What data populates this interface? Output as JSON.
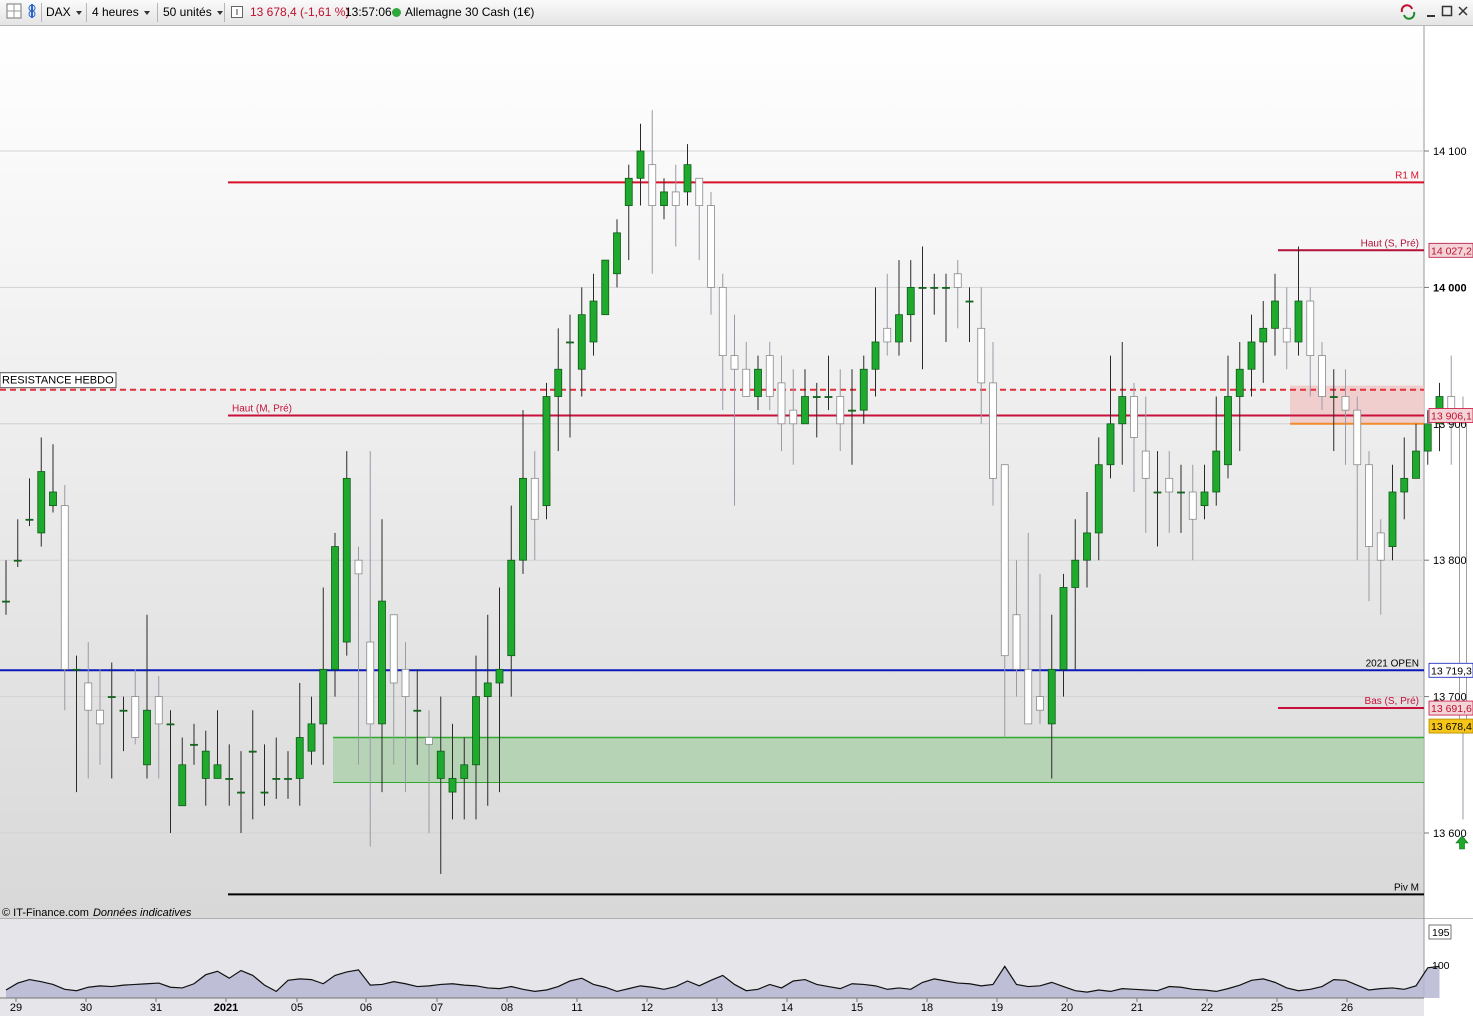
{
  "toolbar": {
    "symbol": "DAX",
    "timeframe": "4 heures",
    "units": "50 unités",
    "price_change": "13 678,4 (-1,61 %)",
    "time": "13:57:06",
    "instrument": "Allemagne 30 Cash (1€)"
  },
  "credit": {
    "source": "© IT-Finance.com",
    "note": "Données indicatives"
  },
  "colors": {
    "bull": "#1faa2e",
    "bear": "#ffffff",
    "resistance": "#d8102a",
    "open_line": "#0b18b8",
    "zone_green": "#a9cfa7",
    "zone_red": "#f0c8c8",
    "orange": "#f08a2a"
  },
  "chart_data": {
    "type": "candlestick",
    "ylim": [
      13540,
      14200
    ],
    "y_ticks": [
      {
        "value": 14100,
        "label": "14 100"
      },
      {
        "value": 14000,
        "label": "14 000"
      },
      {
        "value": 13900,
        "label": "13 900"
      },
      {
        "value": 13800,
        "label": "13 800"
      },
      {
        "value": 13700,
        "label": "13 700"
      },
      {
        "value": 13600,
        "label": "13 600"
      }
    ],
    "x_labels": [
      "29",
      "30",
      "31",
      "2021",
      "05",
      "06",
      "07",
      "08",
      "11",
      "12",
      "13",
      "14",
      "15",
      "18",
      "19",
      "20",
      "21",
      "22",
      "25",
      "26"
    ],
    "levels": [
      {
        "name": "R1 M",
        "value": 14077,
        "style": "solid",
        "color": "#d8102a"
      },
      {
        "name": "Haut (S, Pré)",
        "value": 14027.2,
        "style": "solid",
        "color": "#b3103a",
        "badge": "14 027,2"
      },
      {
        "name": "RESISTANCE HEBDO",
        "value": 13925,
        "style": "dashed",
        "color": "#e0303a"
      },
      {
        "name": "Haut (M, Pré)",
        "value": 13906.1,
        "style": "solid",
        "color": "#c8103a",
        "badge": "13 906,1"
      },
      {
        "name": "2021 OPEN",
        "value": 13719.3,
        "style": "solid",
        "color": "#0b18b8",
        "badge": "13 719,3"
      },
      {
        "name": "Bas (S, Pré)",
        "value": 13691.6,
        "style": "solid",
        "color": "#c8103a",
        "badge": "13 691,6"
      },
      {
        "name": "Piv M",
        "value": 13555,
        "style": "solid",
        "color": "#000000"
      }
    ],
    "last_price": {
      "value": 13678.4,
      "label": "13 678,4"
    },
    "zones": [
      {
        "name": "support-zone",
        "from": 13637,
        "to": 13670
      },
      {
        "name": "resistance-zone",
        "from": 13900,
        "to": 13928
      }
    ],
    "candles": [
      [
        13770,
        13770,
        13800,
        13760
      ],
      [
        13800,
        13800,
        13830,
        13795
      ],
      [
        13830,
        13830,
        13860,
        13825
      ],
      [
        13820,
        13865,
        13890,
        13810
      ],
      [
        13840,
        13850,
        13885,
        13835
      ],
      [
        13840,
        13720,
        13855,
        13690
      ],
      [
        13720,
        13720,
        13730,
        13630
      ],
      [
        13710,
        13690,
        13740,
        13640
      ],
      [
        13690,
        13680,
        13720,
        13650
      ],
      [
        13700,
        13700,
        13725,
        13640
      ],
      [
        13690,
        13690,
        13700,
        13660
      ],
      [
        13700,
        13670,
        13720,
        13665
      ],
      [
        13650,
        13690,
        13760,
        13640
      ],
      [
        13700,
        13680,
        13715,
        13640
      ],
      [
        13680,
        13680,
        13690,
        13600
      ],
      [
        13620,
        13650,
        13670,
        13620
      ],
      [
        13665,
        13665,
        13680,
        13650
      ],
      [
        13640,
        13660,
        13675,
        13620
      ],
      [
        13640,
        13650,
        13690,
        13640
      ],
      [
        13640,
        13640,
        13665,
        13620
      ],
      [
        13630,
        13630,
        13660,
        13600
      ],
      [
        13660,
        13660,
        13690,
        13610
      ],
      [
        13630,
        13630,
        13665,
        13620
      ],
      [
        13640,
        13640,
        13670,
        13625
      ],
      [
        13640,
        13640,
        13660,
        13625
      ],
      [
        13640,
        13670,
        13710,
        13620
      ],
      [
        13660,
        13680,
        13700,
        13650
      ],
      [
        13680,
        13720,
        13780,
        13650
      ],
      [
        13720,
        13810,
        13820,
        13700
      ],
      [
        13740,
        13860,
        13880,
        13730
      ],
      [
        13800,
        13790,
        13810,
        13650
      ],
      [
        13740,
        13680,
        13880,
        13590
      ],
      [
        13680,
        13770,
        13830,
        13630
      ],
      [
        13760,
        13710,
        13740,
        13650
      ],
      [
        13720,
        13700,
        13740,
        13630
      ],
      [
        13690,
        13690,
        13720,
        13650
      ],
      [
        13670,
        13665,
        13690,
        13600
      ],
      [
        13640,
        13660,
        13700,
        13570
      ],
      [
        13630,
        13640,
        13680,
        13610
      ],
      [
        13640,
        13650,
        13670,
        13610
      ],
      [
        13650,
        13700,
        13730,
        13610
      ],
      [
        13700,
        13710,
        13760,
        13620
      ],
      [
        13710,
        13720,
        13780,
        13630
      ],
      [
        13730,
        13800,
        13840,
        13700
      ],
      [
        13800,
        13860,
        13910,
        13790
      ],
      [
        13860,
        13830,
        13880,
        13800
      ],
      [
        13840,
        13920,
        13930,
        13830
      ],
      [
        13920,
        13940,
        13970,
        13880
      ],
      [
        13960,
        13960,
        13980,
        13890
      ],
      [
        13940,
        13980,
        14000,
        13920
      ],
      [
        13960,
        13990,
        14010,
        13950
      ],
      [
        13980,
        14020,
        14020,
        13980
      ],
      [
        14010,
        14040,
        14050,
        14000
      ],
      [
        14060,
        14080,
        14090,
        14020
      ],
      [
        14080,
        14100,
        14120,
        14060
      ],
      [
        14090,
        14060,
        14130,
        14010
      ],
      [
        14060,
        14070,
        14080,
        14050
      ],
      [
        14070,
        14060,
        14090,
        14030
      ],
      [
        14070,
        14090,
        14105,
        14060
      ],
      [
        14080,
        14060,
        14080,
        14020
      ],
      [
        14060,
        14000,
        14070,
        13980
      ],
      [
        14000,
        13950,
        14010,
        13910
      ],
      [
        13950,
        13940,
        13980,
        13840
      ],
      [
        13940,
        13920,
        13960,
        13920
      ],
      [
        13920,
        13940,
        13950,
        13910
      ],
      [
        13950,
        13920,
        13960,
        13910
      ],
      [
        13930,
        13900,
        13950,
        13880
      ],
      [
        13910,
        13900,
        13940,
        13870
      ],
      [
        13900,
        13920,
        13940,
        13900
      ],
      [
        13920,
        13920,
        13930,
        13890
      ],
      [
        13920,
        13920,
        13950,
        13910
      ],
      [
        13920,
        13900,
        13940,
        13880
      ],
      [
        13910,
        13910,
        13940,
        13870
      ],
      [
        13910,
        13940,
        13950,
        13900
      ],
      [
        13940,
        13960,
        14000,
        13920
      ],
      [
        13970,
        13960,
        14010,
        13950
      ],
      [
        13960,
        13980,
        14020,
        13950
      ],
      [
        13980,
        14000,
        14020,
        13960
      ],
      [
        14000,
        14000,
        14030,
        13940
      ],
      [
        14000,
        14000,
        14010,
        13980
      ],
      [
        14000,
        14000,
        14010,
        13960
      ],
      [
        14010,
        14000,
        14020,
        13970
      ],
      [
        13990,
        13990,
        14000,
        13960
      ],
      [
        13970,
        13930,
        14000,
        13900
      ],
      [
        13930,
        13860,
        13960,
        13840
      ],
      [
        13870,
        13730,
        13870,
        13670
      ],
      [
        13760,
        13720,
        13800,
        13700
      ],
      [
        13720,
        13680,
        13820,
        13680
      ],
      [
        13700,
        13690,
        13790,
        13680
      ],
      [
        13680,
        13720,
        13760,
        13640
      ],
      [
        13720,
        13780,
        13790,
        13700
      ],
      [
        13780,
        13800,
        13830,
        13720
      ],
      [
        13800,
        13820,
        13850,
        13780
      ],
      [
        13820,
        13870,
        13890,
        13800
      ],
      [
        13870,
        13900,
        13950,
        13860
      ],
      [
        13900,
        13920,
        13960,
        13870
      ],
      [
        13920,
        13890,
        13930,
        13850
      ],
      [
        13880,
        13860,
        13920,
        13820
      ],
      [
        13850,
        13850,
        13880,
        13810
      ],
      [
        13860,
        13850,
        13880,
        13820
      ],
      [
        13850,
        13850,
        13870,
        13820
      ],
      [
        13850,
        13830,
        13870,
        13800
      ],
      [
        13840,
        13850,
        13870,
        13830
      ],
      [
        13850,
        13880,
        13920,
        13840
      ],
      [
        13870,
        13920,
        13950,
        13860
      ],
      [
        13920,
        13940,
        13960,
        13880
      ],
      [
        13940,
        13960,
        13980,
        13920
      ],
      [
        13960,
        13970,
        13990,
        13930
      ],
      [
        13970,
        13990,
        14010,
        13950
      ],
      [
        13970,
        13960,
        14000,
        13940
      ],
      [
        13960,
        13990,
        14030,
        13950
      ],
      [
        13990,
        13950,
        14000,
        13920
      ],
      [
        13950,
        13920,
        13960,
        13910
      ],
      [
        13920,
        13920,
        13940,
        13880
      ],
      [
        13920,
        13910,
        13940,
        13870
      ],
      [
        13910,
        13870,
        13920,
        13800
      ],
      [
        13870,
        13810,
        13880,
        13770
      ],
      [
        13820,
        13800,
        13830,
        13760
      ],
      [
        13810,
        13850,
        13870,
        13800
      ],
      [
        13850,
        13860,
        13890,
        13830
      ],
      [
        13860,
        13880,
        13900,
        13860
      ],
      [
        13880,
        13900,
        13910,
        13870
      ],
      [
        13900,
        13920,
        13930,
        13880
      ],
      [
        13920,
        13900,
        13950,
        13870
      ],
      [
        13900,
        13680,
        13920,
        13610
      ]
    ],
    "indicator": {
      "labels": [
        {
          "value": 195,
          "label": "195"
        },
        {
          "value": 100,
          "label": "100"
        }
      ],
      "values": [
        28,
        48,
        58,
        52,
        44,
        30,
        26,
        36,
        40,
        38,
        42,
        44,
        46,
        48,
        36,
        34,
        46,
        72,
        82,
        62,
        84,
        70,
        42,
        24,
        56,
        60,
        58,
        46,
        70,
        80,
        86,
        42,
        44,
        52,
        46,
        38,
        40,
        44,
        46,
        42,
        40,
        34,
        32,
        38,
        30,
        24,
        28,
        38,
        54,
        62,
        44,
        36,
        24,
        32,
        40,
        36,
        30,
        38,
        54,
        40,
        56,
        70,
        44,
        26,
        30,
        44,
        34,
        54,
        58,
        44,
        38,
        32,
        46,
        44,
        40,
        30,
        34,
        30,
        50,
        60,
        54,
        48,
        46,
        40,
        44,
        96,
        44,
        38,
        40,
        50,
        38,
        26,
        22,
        28,
        24,
        32,
        30,
        28,
        26,
        38,
        36,
        30,
        28,
        24,
        32,
        42,
        56,
        60,
        50,
        34,
        26,
        30,
        38,
        58,
        56,
        42,
        28,
        32,
        34,
        30,
        40,
        92,
        96
      ]
    }
  }
}
